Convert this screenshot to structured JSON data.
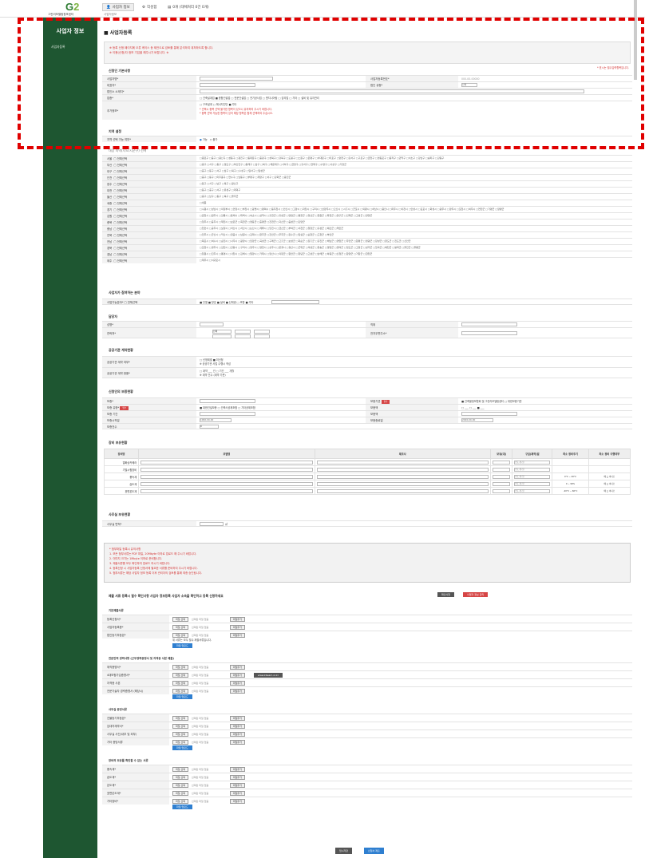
{
  "header": {
    "logo_text": "그린리모델링창조센터",
    "tab_user": "사업자 정보",
    "tab_settings": "작성함",
    "tab_extra": "0개 (대체처리 0건 0개)",
    "breadcrumb": "사업자정보"
  },
  "sidebar": {
    "title": "사업자 정보",
    "items": [
      {
        "label": "사업자등록"
      }
    ]
  },
  "page": {
    "title": "사업자등록",
    "notice_1": "※ 등록 신청 페이지에 오류 케이스 등 제안으로 검토를 통해 분석하여 대처하도록 합니다.",
    "notice_2": "※ 이용(신청)자 정보 기입을 해주시기 바랍니다. ※",
    "required_note": "* 표시는 필수입력항목입니다."
  },
  "basic": {
    "section": "신청인 기본사항",
    "company_name": "사업자명*",
    "biz_number": "사업자등록번호*",
    "biz_number_value": "000-00-00000",
    "ceo": "대표자*",
    "type": "법인 유형*",
    "type_value": "선택",
    "address": "법인소 소재지*",
    "category": "업종*",
    "category_opts": "□ 건축설계업 ■ 종합건설업 □ 전문건설업 □ 전기공사업 □ 엔지니어링 □ 감리업 □ 기타 □ 설비 및 유지관리",
    "extra": "추가정보*",
    "extra_opts": "□ 구조설계 □ 에너지진단 ■ 기타",
    "warn_1": "* 선택시 중복 선택 불가한 항목이 있으니 유의하여 주시기 바랍니다.",
    "warn_2": "* 중복 선택 가능한 항목이 있어 해당 항목은 함께 선택하여 주십시오."
  },
  "area": {
    "section": "지역 설정",
    "label": "지역 선택 가능 여부*",
    "opt_all": "가능",
    "opt_none": "불가",
    "subhead": "대상 지역(시도/시군구) 선택",
    "regions": [
      {
        "label": "서울",
        "all": "전체선택",
        "list": "□종로구 □중구 □용산구 □성동구 □광진구 □동대문구 □중랑구 □성북구 □강북구 □도봉구 □노원구 □은평구 □서대문구 □마포구 □양천구 □강서구 □구로구 □금천구 □영등포구 □동작구 □관악구 □서초구 □강남구 □송파구 □강동구"
      },
      {
        "label": "부산",
        "all": "전체선택",
        "list": "□중구 □서구 □동구 □영도구 □부산진구 □동래구 □남구 □북구 □해운대구 □사하구 □금정구 □강서구 □연제구 □수영구 □사상구 □기장군"
      },
      {
        "label": "대구",
        "all": "전체선택",
        "list": "□중구 □동구 □서구 □남구 □북구 □수성구 □달서구 □달성군"
      },
      {
        "label": "인천",
        "all": "전체선택",
        "list": "□중구 □동구 □미추홀구 □연수구 □남동구 □부평구 □계양구 □서구 □강화군 □옹진군"
      },
      {
        "label": "광주",
        "all": "전체선택",
        "list": "□동구 □서구 □남구 □북구 □광산구"
      },
      {
        "label": "대전",
        "all": "전체선택",
        "list": "□동구 □중구 □서구 □유성구 □대덕구"
      },
      {
        "label": "울산",
        "all": "전체선택",
        "list": "□중구 □남구 □동구 □북구 □울주군"
      },
      {
        "label": "세종",
        "all": "전체선택",
        "list": "□세종"
      },
      {
        "label": "경기",
        "all": "전체선택",
        "list": "□수원시 □성남시 □의정부시 □안양시 □부천시 □광명시 □평택시 □동두천시 □안산시 □고양시 □과천시 □구리시 □남양주시 □오산시 □시흥시 □군포시 □의왕시 □하남시 □용인시 □파주시 □이천시 □안성시 □김포시 □화성시 □광주시 □양주시 □포천시 □여주시 □연천군 □가평군 □양평군"
      },
      {
        "label": "강원",
        "all": "전체선택",
        "list": "□춘천시 □원주시 □강릉시 □동해시 □태백시 □속초시 □삼척시 □홍천군 □횡성군 □영월군 □평창군 □정선군 □철원군 □화천군 □양구군 □인제군 □고성군 □양양군"
      },
      {
        "label": "충북",
        "all": "전체선택",
        "list": "□청주시 □충주시 □제천시 □보은군 □옥천군 □영동군 □증평군 □진천군 □괴산군 □음성군 □단양군"
      },
      {
        "label": "충남",
        "all": "전체선택",
        "list": "□천안시 □공주시 □보령시 □아산시 □서산시 □논산시 □계룡시 □당진시 □금산군 □부여군 □서천군 □청양군 □홍성군 □예산군 □태안군"
      },
      {
        "label": "전북",
        "all": "전체선택",
        "list": "□전주시 □군산시 □익산시 □정읍시 □남원시 □김제시 □완주군 □진안군 □무주군 □장수군 □임실군 □순창군 □고창군 □부안군"
      },
      {
        "label": "전남",
        "all": "전체선택",
        "list": "□목포시 □여수시 □순천시 □나주시 □광양시 □담양군 □곡성군 □구례군 □고흥군 □보성군 □화순군 □장흥군 □강진군 □해남군 □영암군 □무안군 □함평군 □영광군 □장성군 □완도군 □진도군 □신안군"
      },
      {
        "label": "경북",
        "all": "전체선택",
        "list": "□포항시 □경주시 □김천시 □안동시 □구미시 □영주시 □영천시 □상주시 □문경시 □경산시 □군위군 □의성군 □청송군 □영양군 □영덕군 □청도군 □고령군 □성주군 □칠곡군 □예천군 □봉화군 □울진군 □울릉군"
      },
      {
        "label": "경남",
        "all": "전체선택",
        "list": "□창원시 □진주시 □통영시 □사천시 □김해시 □밀양시 □거제시 □양산시 □의령군 □함안군 □창녕군 □고성군 □남해군 □하동군 □산청군 □함양군 □거창군 □합천군"
      },
      {
        "label": "제주",
        "all": "전체선택",
        "list": "□제주시 □서귀포시"
      }
    ]
  },
  "scope": {
    "section": "사업자가 참여하는 분야",
    "label": "사업가능분야* □ 전체선택",
    "opts": "■ 단열 ■ 창호 ■ 설비 ■ 신재생 □ 조명 ■ 기타"
  },
  "manager": {
    "section": "담당자",
    "name": "성명*",
    "position": "직위",
    "phone": "연락처*",
    "phone_sel": "선택",
    "email": "전자우편주소*"
  },
  "insurance": {
    "section": "공공기관 계약현황",
    "label1": "공공기관 계약 여부*",
    "opt1": "□ 신청제출 ■ 미신청",
    "note1": "※ 공공기관 사업 수행시 작성",
    "label2": "공공기관 계약 현황*",
    "val2": "□ 계약 ___ 건   □ 기간 ___ 개월",
    "note2": "※ 계약 건수 (계약 기준)"
  },
  "finance": {
    "section": "신청인의 보증현황",
    "guar": "보증*",
    "guar_org": "보증기관",
    "guar_opts": "■ 건축물정보협회 및 그린리모델링센터 □ 대한보증기관",
    "guar_type": "보증 유형*",
    "guar_type_badge": "필수",
    "guar_type_opts": "■ 대한건설보증 □ 건축사공제조합 □ 기타공제조합",
    "period": "보증 기간",
    "amount": "보증액",
    "start_date": "보증시작일",
    "start_value": "1990-00-00",
    "end_date": "보증종료일",
    "end_value": "2026-00-00",
    "count": "보증건수",
    "count_value": "0"
  },
  "equipment": {
    "section": "장비 보유현황",
    "headers": [
      "장비명",
      "모델명",
      "제조사",
      "보유(대)",
      "구입(제작)일",
      "최소 정비주기",
      "최소 정비 이행여부"
    ],
    "rows": [
      {
        "name": "열화상카메라",
        "date": "연도-월-일",
        "period": "",
        "check": ""
      },
      {
        "name": "기밀시험장비",
        "date": "연도-월-일",
        "period": "",
        "check": ""
      },
      {
        "name": "풍속계",
        "date": "연도-월-일",
        "period": "0°C ~ 40°C",
        "check": "예 □ 아니오"
      },
      {
        "name": "습도계",
        "date": "연도-월-일",
        "period": "0 ~ 99%",
        "check": "예 □ 아니오"
      },
      {
        "name": "표면온도계",
        "date": "연도-월-일",
        "period": "-20°C ~ 60°C",
        "check": "예 □ 아니오"
      }
    ]
  },
  "staff": {
    "section": "사무실 보유현황",
    "label": "사무실 면적*",
    "unit": "㎡"
  },
  "info": {
    "line1": "* 첨부파일 등록시 유의사항",
    "line2": "1. 모든 첨부서류는 PDF 파일, 20Mbyte 이하로 업로드 해 주시기 바랍니다.",
    "line3": "2. 이미지 크기는 1Mbyte 이하로 준비합니다.",
    "line4": "3. 제출서류를 모두 확인하여 업로드 하시기 바랍니다.",
    "line5": "4. 등록신청 시 사업자등록 신청서에 필요한 서류를 준비하여 주시기 바랍니다.",
    "line6": "5. 첨부서류는 해당 사업자 정보 등록 이후 관리자의 검토를 통해 최종 승인됩니다."
  },
  "upload": {
    "title": "제출 서류 등록시 필수 확인사항 사업자 정보등록 사업자 소속을 확인하고 등록 신청하세요",
    "btn_a": "확인사항",
    "btn_b": "사업자 정보 관리",
    "groups": [
      {
        "head": "기본제출서류",
        "items": [
          "등록신청서*",
          "사업자등록증*",
          "법인등기부등본*"
        ],
        "note": "위 서류는 모두 필수 제출서류입니다.",
        "submit": "파일 업로드"
      },
      {
        "head": "전문인력 경력사항 (근무경력증명서 및 자격증 사본 제출)",
        "items": [
          "재직증명서*",
          "4대보험가입증명서*",
          "자격증 사본",
          "전문기술자 경력증명서 (해당시)"
        ],
        "note": "",
        "submit": "파일 업로드",
        "link": "www.kbeam.or.kr"
      },
      {
        "head": "사무실 증빙서류",
        "items": [
          "건물등기부등본*",
          "임대차계약서*",
          "사무실 사진(내부 및 외부)",
          "기타 증빙서류"
        ],
        "note": "",
        "submit": "파일 업로드"
      },
      {
        "head": "장비의 보유를 확인할 수 있는 서류",
        "items": [
          "풍속계*",
          "습도계*",
          "온도계*",
          "표면온도계*",
          "기타장비*"
        ],
        "note": "",
        "submit": "파일 업로드"
      }
    ],
    "file_btn": "파일 선택",
    "file_none": "선택된 파일 없음",
    "file_add": "파일추가"
  },
  "footer": {
    "btn_cancel": "임시저장",
    "btn_save": "신청서 제출"
  }
}
